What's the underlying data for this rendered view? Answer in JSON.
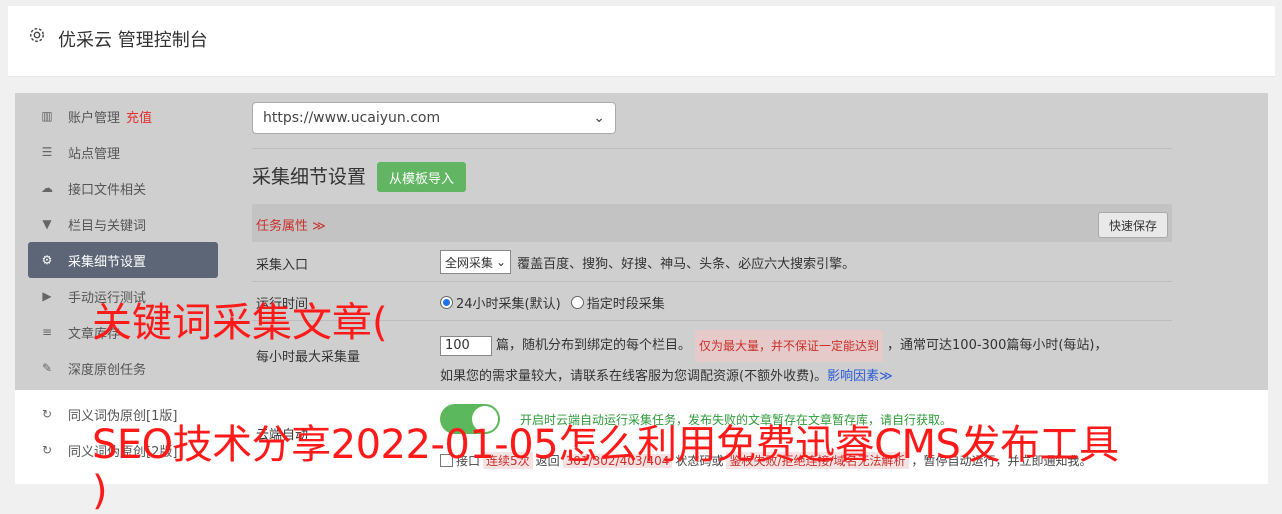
{
  "header": {
    "title": "优采云 管理控制台",
    "icon": "gear-icon"
  },
  "sidebar": {
    "items": [
      {
        "label": "账户管理",
        "extra": "充值",
        "icon": "bar-chart-icon"
      },
      {
        "label": "站点管理",
        "icon": "server-icon"
      },
      {
        "label": "接口文件相关",
        "icon": "cloud-upload-icon"
      },
      {
        "label": "栏目与关键词",
        "icon": "filter-icon"
      },
      {
        "label": "采集细节设置",
        "icon": "gears-icon",
        "active": true
      },
      {
        "label": "手动运行测试",
        "icon": "play-icon"
      },
      {
        "label": "文章库存",
        "icon": "database-icon"
      },
      {
        "label": "深度原创任务",
        "icon": "edit-icon"
      },
      {
        "label": "同义词伪原创[1版]",
        "icon": "refresh-icon"
      },
      {
        "label": "同义词伪原创[2版]",
        "icon": "refresh-icon"
      }
    ]
  },
  "main": {
    "site_select": "https://www.ucaiyun.com",
    "section_title": "采集细节设置",
    "import_button": "从模板导入",
    "task_attr": "任务属性 ≫",
    "quick_save": "快速保存",
    "rows": {
      "entry": {
        "label": "采集入口",
        "select": "全网采集",
        "desc": "覆盖百度、搜狗、好搜、神马、头条、必应六大搜索引擎。"
      },
      "time": {
        "label": "运行时间",
        "opt1": "24小时采集(默认)",
        "opt2": "指定时段采集"
      },
      "max": {
        "label": "每小时最大采集量",
        "value": "100",
        "desc1": "篇，随机分布到绑定的每个栏目。",
        "tag": "仅为最大量，并不保证一定能达到",
        "desc2": "，通常可达100-300篇每小时(每站)，",
        "desc3": "如果您的需求量较大，请联系在线客服为您调配资源(不额外收费)。",
        "link": "影响因素≫"
      },
      "auto": {
        "label": "云端自动",
        "green": "开启时云端自动运行采集任务，发布失败的文章暂存在文章暂存库，请自行获取。",
        "cb_label": "接口",
        "cb_tag1": "连续5次",
        "cb_text1": "返回",
        "cb_tag2": "301/302/403/404",
        "cb_text2": "状态码或",
        "cb_tag3": "鉴权失败/拒绝连接/域名无法解析",
        "cb_text3": "，暂停自动运行，并立即通知我。"
      }
    }
  },
  "overlay": {
    "line1": "关键词采集文章(",
    "line2": "SEO技术分享2022-01-05怎么利用免费迅睿CMS发布工具",
    "line3": ")"
  },
  "colors": {
    "active_bg": "#5c6676",
    "green": "#62b562",
    "overlay_red": "#ff1a1a"
  }
}
